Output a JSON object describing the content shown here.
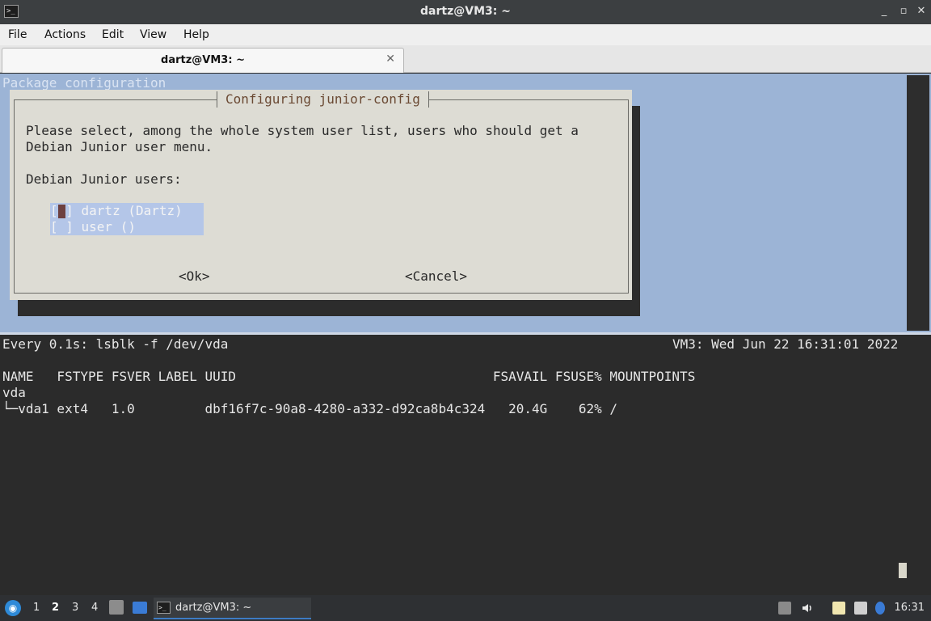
{
  "window": {
    "title": "dartz@VM3: ~",
    "app_icon_glyph": ">_",
    "controls": [
      "_",
      "▫",
      "✕"
    ]
  },
  "menu": [
    "File",
    "Actions",
    "Edit",
    "View",
    "Help"
  ],
  "tab": {
    "label": "dartz@VM3: ~",
    "close": "✕"
  },
  "dialog": {
    "backdrop_title": "Package configuration",
    "title": "Configuring junior-config",
    "message_line1": "Please select, among the whole system user list, users who should get a",
    "message_line2": "Debian Junior user menu.",
    "list_label": "Debian Junior users:",
    "items": [
      "[ ] dartz (Dartz)",
      "[ ] user ()"
    ],
    "ok_label": "<Ok>",
    "cancel_label": "<Cancel>"
  },
  "watch": {
    "header_left": "Every 0.1s: lsblk -f /dev/vda",
    "header_right": "VM3: Wed Jun 22 16:31:01 2022",
    "columns_line": "NAME   FSTYPE FSVER LABEL UUID                                 FSAVAIL FSUSE% MOUNTPOINTS",
    "rows": [
      "vda",
      "└─vda1 ext4   1.0         dbf16f7c-90a8-4280-a332-d92ca8b4c324   20.4G    62% /"
    ]
  },
  "taskbar": {
    "logo": "◉",
    "workspaces": [
      "1",
      "2",
      "3",
      "4"
    ],
    "active_workspace": "2",
    "task_label": "dartz@VM3: ~",
    "task_icon": ">_",
    "clock": "16:31"
  },
  "colors": {
    "dialog_backdrop": "#9cb4d6",
    "dialog_bg": "#dddcd4",
    "dialog_title": "#6b4a34",
    "terminal_bg": "#2b2b2b",
    "selection": "#b4c6e8"
  }
}
